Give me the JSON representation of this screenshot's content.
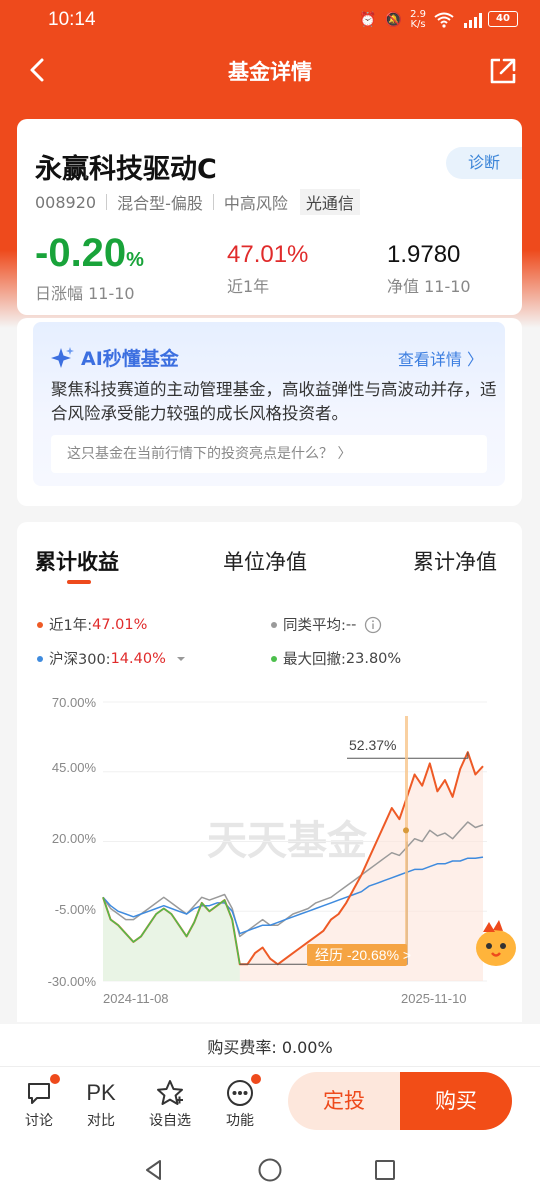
{
  "status": {
    "time": "10:14",
    "net_speed": "2.9\nK/s",
    "battery": "40"
  },
  "nav": {
    "title": "基金详情"
  },
  "fund": {
    "name": "永赢科技驱动C",
    "diagnose_label": "诊断",
    "code": "008920",
    "type": "混合型-偏股",
    "risk": "中高风险",
    "theme_tag": "光通信",
    "daily_change": "-0.20",
    "daily_change_unit": "%",
    "daily_change_label": "日涨幅 11-10",
    "year_return": "47.01%",
    "year_return_label": "近1年",
    "nav_value": "1.9780",
    "nav_label": "净值 11-10"
  },
  "ai": {
    "title": "AI秒懂基金",
    "more": "查看详情 〉",
    "desc": "聚焦科技赛道的主动管理基金，高收益弹性与高波动并存，适合风险承受能力较强的成长风格投资者。",
    "question": "这只基金在当前行情下的投资亮点是什么？ 〉"
  },
  "chart_tabs": [
    "累计收益",
    "单位净值",
    "累计净值"
  ],
  "legend": {
    "fund_label": "近1年:",
    "fund_value": "47.01%",
    "peer_label": "同类平均:",
    "peer_value": "--",
    "index_label": "沪深300:",
    "index_value": "14.40%",
    "drawdown_label": "最大回撤:",
    "drawdown_value": "23.80%"
  },
  "chart_text": {
    "watermark": "天天基金",
    "peak_label": "52.37%",
    "drawdown_flag": "经历 -20.68% >"
  },
  "colors": {
    "fund": "#ee5a26",
    "peer": "#9a9a9a",
    "index": "#3f8bde",
    "drawdown": "#4cbf4c"
  },
  "chart_data": {
    "type": "line",
    "x_start": "2024-11-08",
    "x_end": "2025-11-10",
    "y_ticks": [
      "70.00%",
      "45.00%",
      "20.00%",
      "-5.00%",
      "-30.00%"
    ],
    "ylim": [
      -30,
      70
    ],
    "series": [
      {
        "name": "近1年",
        "values": [
          0,
          -8,
          -10,
          -13,
          -16,
          -14,
          -10,
          -6,
          -4,
          -6,
          -10,
          -14,
          -9,
          -2,
          -5,
          -3,
          -1,
          -8,
          -24,
          -24,
          -20,
          -18,
          -22,
          -24,
          -22,
          -20,
          -18,
          -16,
          -14,
          -12,
          -8,
          -6,
          -2,
          3,
          8,
          14,
          20,
          26,
          32,
          28,
          36,
          44,
          40,
          48,
          38,
          42,
          36,
          46,
          52,
          44,
          47
        ]
      },
      {
        "name": "同类平均",
        "values": [
          0,
          -4,
          -6,
          -8,
          -8,
          -6,
          -4,
          -2,
          0,
          -2,
          -4,
          -6,
          -3,
          0,
          -1,
          0,
          1,
          -4,
          -14,
          -12,
          -10,
          -8,
          -10,
          -10,
          -8,
          -6,
          -5,
          -4,
          -2,
          -1,
          0,
          2,
          4,
          6,
          8,
          10,
          12,
          14,
          16,
          15,
          18,
          21,
          20,
          24,
          22,
          23,
          21,
          24,
          27,
          25,
          26
        ]
      },
      {
        "name": "沪深300",
        "values": [
          0,
          -3,
          -5,
          -6,
          -7,
          -6,
          -5,
          -4,
          -3,
          -4,
          -5,
          -6,
          -4,
          -3,
          -3,
          -2,
          -2,
          -5,
          -13,
          -12,
          -11,
          -10,
          -10,
          -9,
          -8,
          -7,
          -6,
          -5,
          -4,
          -3,
          -2,
          -1,
          0,
          1,
          2,
          4,
          5,
          6,
          7,
          8,
          9,
          10,
          10,
          11,
          12,
          12,
          13,
          13,
          14,
          14,
          14.4
        ]
      },
      {
        "name": "最大回撤",
        "values": [
          0,
          -8,
          -10,
          -13,
          -16,
          -14,
          -10,
          -6,
          -4,
          -6,
          -10,
          -14,
          -9,
          -2,
          -5,
          -3,
          -1,
          -8,
          -24
        ]
      }
    ]
  },
  "bottom": {
    "fee": "购买费率:  0.00%",
    "tools": [
      "讨论",
      "对比",
      "设自选",
      "功能"
    ],
    "pk_label": "PK",
    "sip_label": "定投",
    "buy_label": "购买"
  }
}
